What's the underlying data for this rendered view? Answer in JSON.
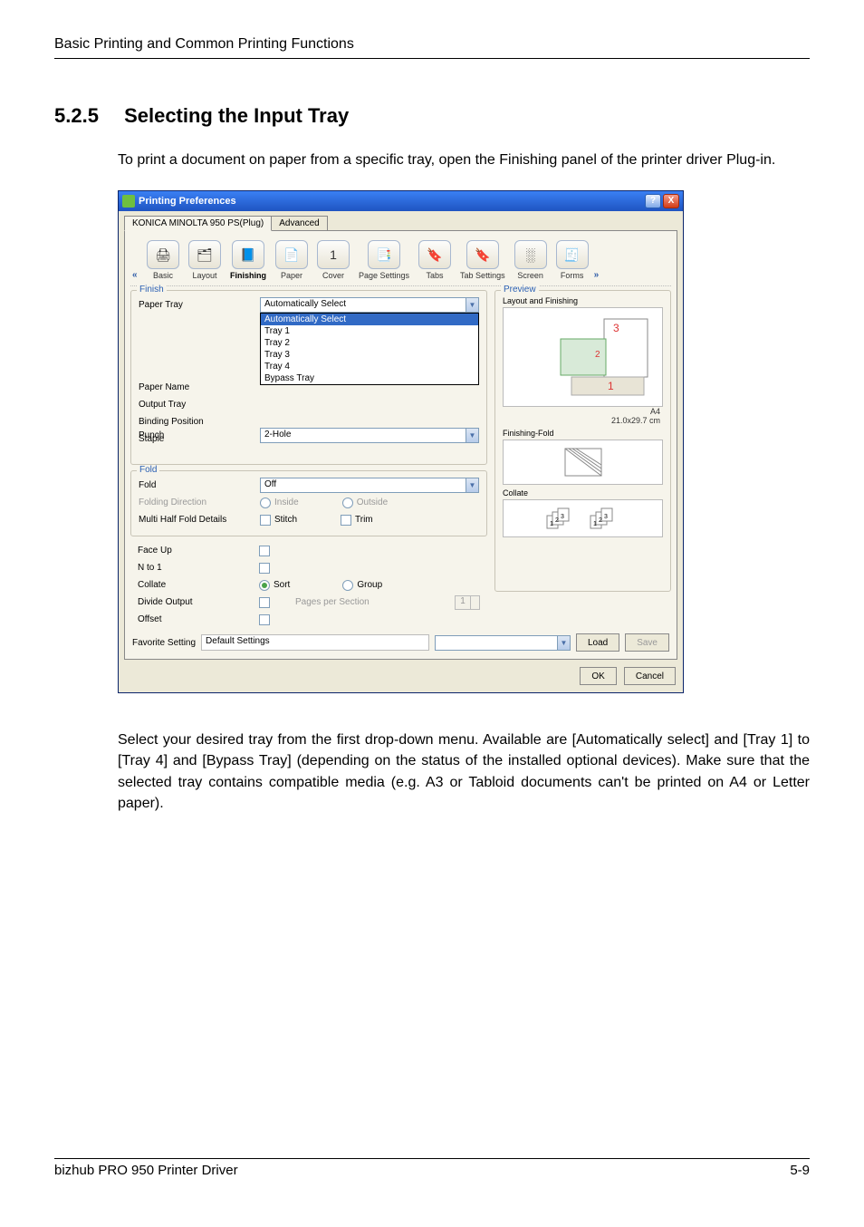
{
  "doc": {
    "header": "Basic Printing and Common Printing Functions",
    "section_number": "5.2.5",
    "section_title": "Selecting the Input Tray",
    "intro": "To print a document on paper from a specific tray, open the Finishing panel of the printer driver Plug-in.",
    "followup": "Select your desired tray from the first drop-down menu. Available are [Automatically select] and [Tray 1] to [Tray 4] and [Bypass Tray] (depending on the status of the installed optional devices). Make sure that the selected tray contains compatible media (e.g. A3 or Tabloid documents can't be printed on A4 or Letter paper).",
    "footer_left": "bizhub PRO 950 Printer Driver",
    "footer_right": "5-9"
  },
  "dialog": {
    "title": "Printing Preferences",
    "tabs": {
      "main": "KONICA MINOLTA 950 PS(Plug)",
      "adv": "Advanced"
    },
    "toolbar": [
      "Basic",
      "Layout",
      "Finishing",
      "Paper",
      "Cover",
      "Page Settings",
      "Tabs",
      "Tab Settings",
      "Screen",
      "Forms"
    ],
    "finish": {
      "legend": "Finish",
      "paper_tray_lbl": "Paper Tray",
      "paper_tray_val": "Automatically Select",
      "paper_tray_options": [
        "Automatically Select",
        "Tray 1",
        "Tray 2",
        "Tray 3",
        "Tray 4",
        "Bypass Tray"
      ],
      "paper_name_lbl": "Paper Name",
      "output_tray_lbl": "Output Tray",
      "binding_lbl": "Binding Position",
      "staple_lbl": "Staple",
      "punch_lbl": "Punch",
      "punch_val": "2-Hole"
    },
    "fold": {
      "legend": "Fold",
      "fold_lbl": "Fold",
      "fold_val": "Off",
      "dir_lbl": "Folding Direction",
      "inside": "Inside",
      "outside": "Outside",
      "multi_lbl": "Multi Half Fold Details",
      "stitch": "Stitch",
      "trim": "Trim"
    },
    "opts": {
      "faceup": "Face Up",
      "nto1": "N to 1",
      "collate": "Collate",
      "sort": "Sort",
      "group": "Group",
      "divide": "Divide Output",
      "pps": "Pages per Section",
      "pps_val": "1",
      "offset": "Offset"
    },
    "preview": {
      "legend": "Preview",
      "layout_label": "Layout and Finishing",
      "paper_size": "A4",
      "paper_dim": "21.0x29.7 cm",
      "finishing_fold": "Finishing-Fold",
      "collate": "Collate"
    },
    "bottom": {
      "fav_lbl": "Favorite Setting",
      "fav_val": "Default Settings",
      "load": "Load",
      "save": "Save",
      "ok": "OK",
      "cancel": "Cancel"
    }
  }
}
